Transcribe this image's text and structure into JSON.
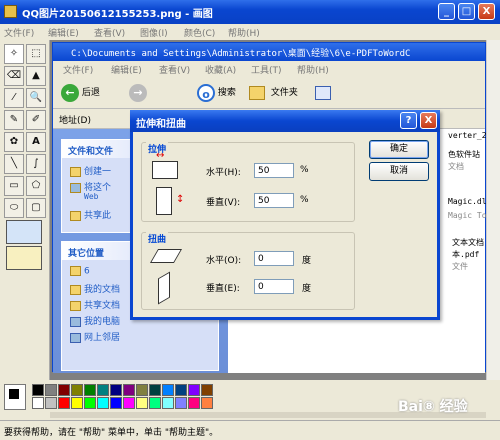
{
  "window": {
    "title": "QQ图片20150612155253.png - 画图",
    "minimize": "_",
    "maximize": "□",
    "close": "X"
  },
  "menu": [
    "文件(F)",
    "编辑(E)",
    "查看(V)",
    "图像(I)",
    "颜色(C)",
    "帮助(H)"
  ],
  "tools": [
    "✧",
    "⬚",
    "⌫",
    "▲",
    "⁄",
    "🔍",
    "✎",
    "✐",
    "✿",
    "A",
    "╲",
    "∫",
    "▭",
    "⬠",
    "⬭",
    "▢"
  ],
  "explorer": {
    "title": "C:\\Documents and Settings\\Administrator\\桌面\\经验\\6\\e-PDFToWordC",
    "menu": [
      "文件(F)",
      "编辑(E)",
      "查看(V)",
      "收藏(A)",
      "工具(T)",
      "帮助(H)"
    ],
    "back_label": "后退",
    "search_label": "搜索",
    "folders_label": "文件夹",
    "address_label": "地址(D)",
    "tasks_title": "文件和文件",
    "tasks": [
      "创建一",
      "将这个",
      "Web",
      "共享此"
    ],
    "other_title": "其它位置",
    "other": [
      "6",
      "我的文档",
      "共享文档",
      "我的电脑",
      "网上邻居"
    ],
    "right_items": [
      "verter_2",
      "色软件站",
      "文档",
      "Magic.dll",
      "Magic Too",
      "文本文档",
      "本.pdf",
      "文件"
    ]
  },
  "dialog": {
    "title": "拉伸和扭曲",
    "help_btn": "?",
    "close_btn": "X",
    "stretch_group": "拉伸",
    "skew_group": "扭曲",
    "h_label": "水平(H):",
    "v_label": "垂直(V):",
    "skew_h_label": "水平(O):",
    "skew_v_label": "垂直(E):",
    "stretch_h": "50",
    "stretch_v": "50",
    "skew_h": "0",
    "skew_v": "0",
    "percent": "%",
    "degree": "度",
    "ok": "确定",
    "cancel": "取消"
  },
  "palette": [
    "#000000",
    "#808080",
    "#800000",
    "#808000",
    "#008000",
    "#008080",
    "#000080",
    "#800080",
    "#808040",
    "#004040",
    "#0080ff",
    "#004080",
    "#8000ff",
    "#804000",
    "#ffffff",
    "#c0c0c0",
    "#ff0000",
    "#ffff00",
    "#00ff00",
    "#00ffff",
    "#0000ff",
    "#ff00ff",
    "#ffff80",
    "#00ff80",
    "#80ffff",
    "#8080ff",
    "#ff0080",
    "#ff8040"
  ],
  "watermark": "Bai⑧ 经验",
  "status": "要获得帮助，请在 \"帮助\" 菜单中，单击 \"帮助主题\"。"
}
